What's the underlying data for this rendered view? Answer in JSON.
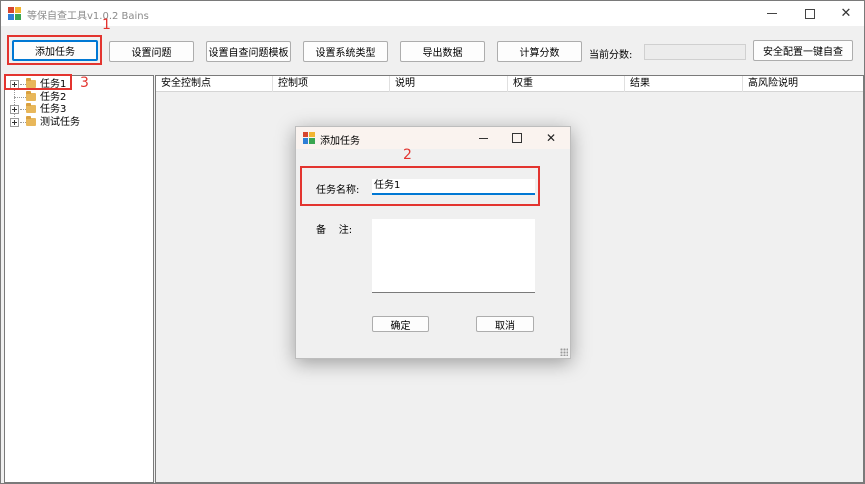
{
  "window": {
    "title": "等保自查工具v1.0.2 Bains",
    "close_glyph": "✕"
  },
  "toolbar": {
    "add_task": "添加任务",
    "set_questions": "设置问题",
    "set_template": "设置自查问题模板",
    "set_system_type": "设置系统类型",
    "export_data": "导出数据",
    "calc_score": "计算分数",
    "current_score_label": "当前分数:",
    "one_click_check": "安全配置一键自查"
  },
  "tree": {
    "items": [
      "任务1",
      "任务2",
      "任务3",
      "测试任务"
    ]
  },
  "grid": {
    "columns": [
      "安全控制点",
      "控制项",
      "说明",
      "权重",
      "结果",
      "高风险说明"
    ]
  },
  "dialog": {
    "title": "添加任务",
    "close_glyph": "✕",
    "name_label": "任务名称:",
    "name_value": "任务1",
    "remark_label": "备    注:",
    "ok": "确定",
    "cancel": "取消"
  },
  "annotations": {
    "step1": "1",
    "step2": "2",
    "step3": "3",
    "color": "#e3342f"
  },
  "colors": {
    "accent": "#0078d4",
    "folder": "#e8b75a"
  }
}
